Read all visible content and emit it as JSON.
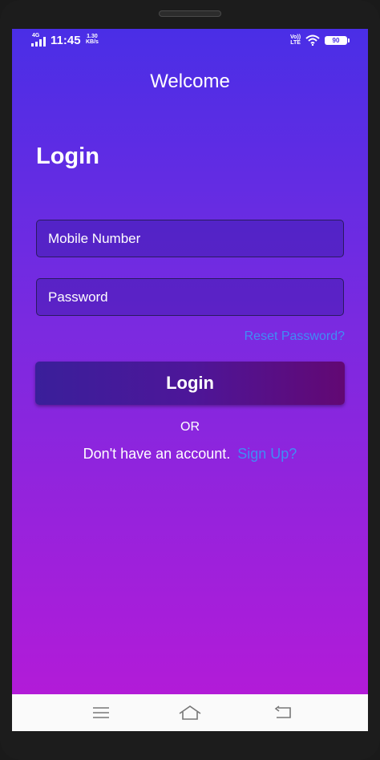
{
  "status_bar": {
    "network": "4G",
    "time": "11:45",
    "speed_value": "1.30",
    "speed_unit": "KB/s",
    "volte_line1": "Vo))",
    "volte_line2": "LTE",
    "battery": "90"
  },
  "header": {
    "title": "Welcome"
  },
  "login_form": {
    "title": "Login",
    "mobile_placeholder": "Mobile Number",
    "password_placeholder": "Password",
    "reset_link": "Reset Password?",
    "login_button": "Login",
    "or_text": "OR",
    "signup_prompt": "Don't have an account.",
    "signup_link": "Sign Up?"
  },
  "colors": {
    "gradient_top": "#4a2ee6",
    "gradient_bottom": "#b21bd8",
    "link": "#3f8df5"
  },
  "nav_bar": {
    "icons": [
      "menu-icon",
      "home-icon",
      "back-icon"
    ]
  }
}
